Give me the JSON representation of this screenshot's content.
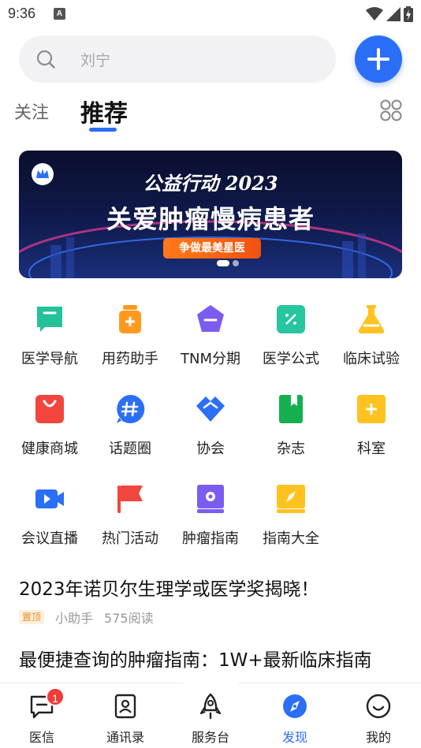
{
  "status_bar": {
    "time": "9:36",
    "notification_glyph": "A"
  },
  "search": {
    "placeholder": "刘宁"
  },
  "tabs": {
    "follow": "关注",
    "recommend": "推荐"
  },
  "banner": {
    "title_line1": "公益行动 2023",
    "title_line2": "关爱肿瘤慢病患者",
    "badge": "争做最美星医",
    "slides": 2,
    "active_slide": 1
  },
  "grid": [
    {
      "label": "医学导航",
      "icon": "bookmark-icon",
      "color": "#23c29a"
    },
    {
      "label": "用药助手",
      "icon": "medicine-bottle-icon",
      "color": "#ff9a1f"
    },
    {
      "label": "TNM分期",
      "icon": "stage-icon",
      "color": "#7b5cf0"
    },
    {
      "label": "医学公式",
      "icon": "formula-icon",
      "color": "#25c6a0"
    },
    {
      "label": "临床试验",
      "icon": "flask-icon",
      "color": "#ffc21f"
    },
    {
      "label": "健康商城",
      "icon": "shopping-bag-icon",
      "color": "#f2453d"
    },
    {
      "label": "话题圈",
      "icon": "hashtag-icon",
      "color": "#2b6ef7"
    },
    {
      "label": "协会",
      "icon": "handshake-icon",
      "color": "#2b6ef7"
    },
    {
      "label": "杂志",
      "icon": "magazine-icon",
      "color": "#14b050"
    },
    {
      "label": "科室",
      "icon": "department-icon",
      "color": "#ffc21f"
    },
    {
      "label": "会议直播",
      "icon": "video-camera-icon",
      "color": "#2b6ef7"
    },
    {
      "label": "热门活动",
      "icon": "flag-icon",
      "color": "#f2453d"
    },
    {
      "label": "肿瘤指南",
      "icon": "guide-book-icon",
      "color": "#7b5cf0"
    },
    {
      "label": "指南大全",
      "icon": "compass-book-icon",
      "color": "#ffc21f"
    }
  ],
  "articles": [
    {
      "title": "2023年诺贝尔生理学或医学奖揭晓！",
      "badge": "置顶",
      "author": "小助手",
      "reads": "575阅读"
    },
    {
      "title": "最便捷查询的肿瘤指南：1W+最新临床指南"
    }
  ],
  "bottom_nav": [
    {
      "label": "医信",
      "icon": "message-icon",
      "badge": "1"
    },
    {
      "label": "通讯录",
      "icon": "contacts-icon"
    },
    {
      "label": "服务台",
      "icon": "rocket-icon"
    },
    {
      "label": "发现",
      "icon": "compass-icon",
      "active": true
    },
    {
      "label": "我的",
      "icon": "smile-icon"
    }
  ],
  "colors": {
    "accent": "#2b6ef7",
    "badge_red": "#f23b3b",
    "pin_orange": "#ef8a2b"
  }
}
